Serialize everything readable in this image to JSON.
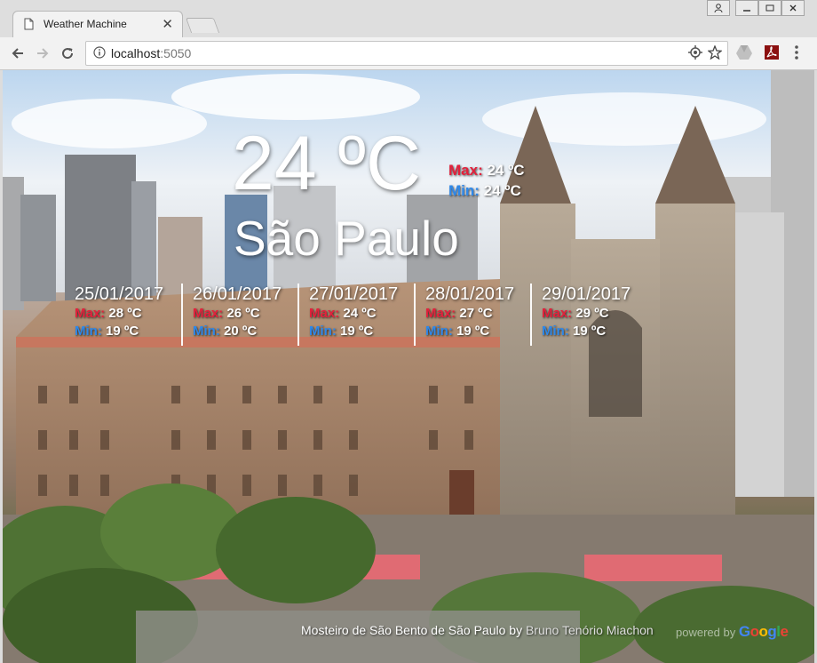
{
  "browser": {
    "tab_title": "Weather Machine",
    "url_host": "localhost",
    "url_port": ":5050"
  },
  "weather": {
    "current_temp": "24 ºC",
    "max_label": "Max:",
    "min_label": "Min:",
    "current_max": "24 ºC",
    "current_min": "24 ºC",
    "city": "São Paulo",
    "forecast": [
      {
        "date": "25/01/2017",
        "max": "28 ºC",
        "min": "19 ºC"
      },
      {
        "date": "26/01/2017",
        "max": "26 ºC",
        "min": "20 ºC"
      },
      {
        "date": "27/01/2017",
        "max": "24 ºC",
        "min": "19 ºC"
      },
      {
        "date": "28/01/2017",
        "max": "27 ºC",
        "min": "19 ºC"
      },
      {
        "date": "29/01/2017",
        "max": "29 ºC",
        "min": "19 ºC"
      }
    ]
  },
  "photo_credit": {
    "title": "Mosteiro de São Bento de São Paulo",
    "by": "by",
    "author": "Bruno Tenório Miachon",
    "powered_by": "powered by",
    "google": "Google"
  },
  "colors": {
    "max": "#e3213c",
    "min": "#2f88e8"
  }
}
